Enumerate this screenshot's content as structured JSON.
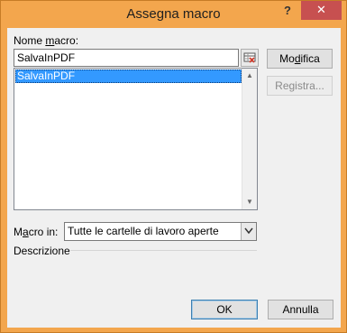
{
  "window": {
    "title": "Assegna macro",
    "help_label": "?",
    "close_label": "✕"
  },
  "macro_name": {
    "label_before": "Nome ",
    "label_underlined": "m",
    "label_after": "acro:",
    "value": "SalvaInPDF"
  },
  "macro_list": {
    "items": [
      "SalvaInPDF"
    ],
    "selected_index": 0
  },
  "buttons": {
    "modifica_before": "Mo",
    "modifica_underlined": "d",
    "modifica_after": "ifica",
    "registra": "Registra...",
    "ok": "OK",
    "annulla": "Annulla"
  },
  "macro_in": {
    "label_before": "M",
    "label_underlined": "a",
    "label_after": "cro in:",
    "selected": "Tutte le cartelle di lavoro aperte"
  },
  "description": {
    "label": "Descrizione"
  },
  "colors": {
    "titlebar": "#f3a64d",
    "close_button": "#c75050",
    "selection": "#3399ff"
  },
  "icons": {
    "ref_button": "range-select-icon",
    "dropdown": "chevron-down-icon"
  }
}
